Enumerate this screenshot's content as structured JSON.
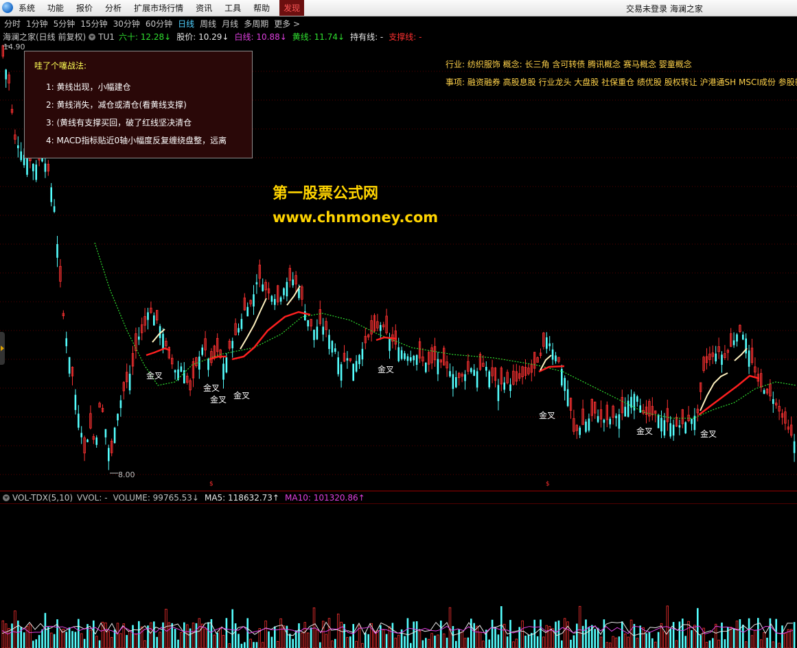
{
  "menu": {
    "items": [
      "系统",
      "功能",
      "报价",
      "分析",
      "扩展市场行情",
      "资讯",
      "工具",
      "帮助",
      "发现"
    ],
    "active": "发现",
    "right_text": "交易未登录  海澜之家"
  },
  "periods": {
    "items": [
      "分时",
      "1分钟",
      "5分钟",
      "15分钟",
      "30分钟",
      "60分钟",
      "日线",
      "周线",
      "月线",
      "多周期",
      "更多 >"
    ],
    "active": "日线"
  },
  "stock_info": {
    "name": "海澜之家(日线 前复权)",
    "indicator": "TU1",
    "fields": [
      {
        "label": "六十:",
        "value": "12.28",
        "arrow": "↓",
        "color": "#30e030"
      },
      {
        "label": "股价:",
        "value": "10.29",
        "arrow": "↓",
        "color": "#e8e8e8"
      },
      {
        "label": "白线:",
        "value": "10.88",
        "arrow": "↓",
        "color": "#e040e0"
      },
      {
        "label": "黄线:",
        "value": "11.74",
        "arrow": "↓",
        "color": "#30e030"
      },
      {
        "label": "持有线:",
        "value": "-",
        "arrow": "",
        "color": "#e8e8e8"
      },
      {
        "label": "支撑线:",
        "value": "-",
        "arrow": "",
        "color": "#ff3030"
      }
    ]
  },
  "popup": {
    "title": "哇了个噻战法:",
    "items": [
      "1: 黄线出现，小幅建仓",
      "2: 黄线消失，减仓或清仓(看黄线支撑)",
      "3: (黄线有支撑买回，破了红线坚决清仓",
      "4: MACD指标贴近0轴小幅度反复缠绕盘整，远离"
    ]
  },
  "right_info": {
    "industry": "行业: 纺织服饰    概念: 长三角 含可转债 腾讯概念 赛马概念 婴童概念",
    "events": "事项: 融资融券 高股息股 行业龙头 大盘股 社保重仓 绩优股 股权转让 沪港通SH MSCI成份 参股新"
  },
  "watermark": {
    "line1": "第一股票公式网",
    "line2": "www.chnmoney.com"
  },
  "price_labels": {
    "high": "14.90",
    "low": "8.00"
  },
  "cross_label": "金叉",
  "vol_info": {
    "name": "VOL-TDX(5,10)",
    "fields": [
      {
        "label": "VVOL:",
        "value": "-",
        "arrow": "",
        "color": "#c0c0c0"
      },
      {
        "label": "VOLUME:",
        "value": "99765.53",
        "arrow": "↓",
        "color": "#c0c0c0"
      },
      {
        "label": "MA5:",
        "value": "118632.73",
        "arrow": "↑",
        "color": "#e8e8e8"
      },
      {
        "label": "MA10:",
        "value": "101320.86",
        "arrow": "↑",
        "color": "#e040e0"
      }
    ]
  },
  "colors": {
    "up": "#ff3232",
    "down": "#54ffff",
    "ma_green": "#30e030",
    "white_line": "#fff2c0",
    "red_line": "#ff2020"
  }
}
